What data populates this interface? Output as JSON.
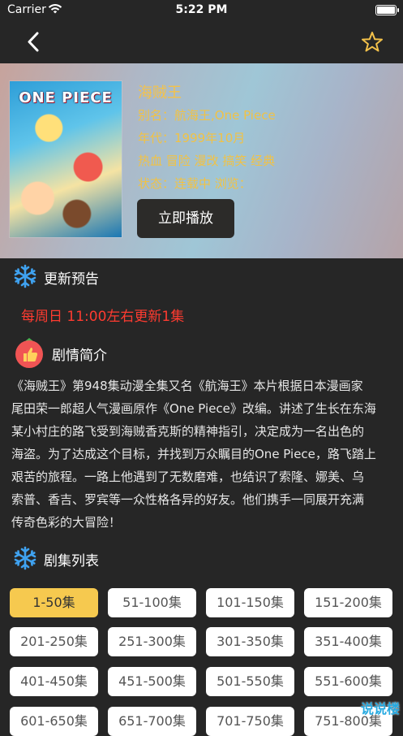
{
  "status": {
    "carrier": "Carrier",
    "time": "5:22 PM"
  },
  "nav": {
    "back_icon": "chevron-left-icon",
    "favorite_icon": "star-outline-icon"
  },
  "anime": {
    "title": "海贼王",
    "alias": "别名：航海王,One Piece",
    "year": "年代：1999年10月",
    "tags": "热血 冒险 漫改 搞笑 经典",
    "status": "状态：连载中 浏览：",
    "poster_logo": "ONE PIECE",
    "play_label": "立即播放"
  },
  "update": {
    "heading": "更新预告",
    "notice": "每周日 11:00左右更新1集"
  },
  "plot": {
    "heading": "剧情简介",
    "lines": [
      "《海贼王》第948集动漫全集又名《航海王》本片根据日本漫画家",
      "尾田荣一郎超人气漫画原作《One Piece》改编。讲述了生长在东海",
      "某小村庄的路飞受到海贼香克斯的精神指引，决定成为一名出色的",
      "海盗。为了达成这个目标，并找到万众瞩目的One Piece，路飞踏上",
      "艰苦的旅程。一路上他遇到了无数磨难，也结识了索隆、娜美、乌",
      "索普、香吉、罗宾等一众性格各异的好友。他们携手一同展开充满",
      "传奇色彩的大冒险！"
    ]
  },
  "episodes": {
    "heading": "剧集列表",
    "items": [
      "1-50集",
      "51-100集",
      "101-150集",
      "151-200集",
      "201-250集",
      "251-300集",
      "301-350集",
      "351-400集",
      "401-450集",
      "451-500集",
      "501-550集",
      "551-600集",
      "601-650集",
      "651-700集",
      "701-750集",
      "751-800集"
    ],
    "active_index": 0
  },
  "watermark": "说说楼",
  "colors": {
    "accent": "#f4c24a",
    "notice": "#ff3b30",
    "background": "#262626",
    "active_episode": "#f6c94f"
  }
}
